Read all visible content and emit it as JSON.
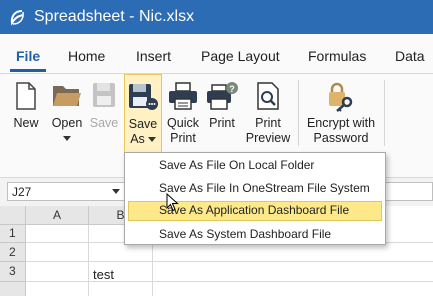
{
  "window": {
    "title": "Spreadsheet - Nic.xlsx",
    "accent_color": "#2b6cb5"
  },
  "tabs": [
    {
      "label": "File",
      "active": true
    },
    {
      "label": "Home"
    },
    {
      "label": "Insert"
    },
    {
      "label": "Page Layout"
    },
    {
      "label": "Formulas"
    },
    {
      "label": "Data"
    }
  ],
  "ribbon": {
    "new": {
      "label": "New",
      "icon": "new-document-icon"
    },
    "open": {
      "label": "Open",
      "icon": "folder-open-icon"
    },
    "save": {
      "label": "Save",
      "icon": "floppy-disk-icon",
      "disabled": true
    },
    "save_as": {
      "line1": "Save",
      "line2": "As",
      "icon": "save-as-icon"
    },
    "quick_print": {
      "line1": "Quick",
      "line2": "Print",
      "icon": "printer-icon"
    },
    "print": {
      "label": "Print",
      "icon": "printer-help-icon"
    },
    "print_preview": {
      "line1": "Print",
      "line2": "Preview",
      "icon": "print-preview-icon"
    },
    "encrypt": {
      "line1": "Encrypt with",
      "line2": "Password",
      "icon": "padlock-key-icon"
    }
  },
  "name_box": {
    "value": "J27"
  },
  "save_as_menu": [
    {
      "label": "Save As File On Local Folder"
    },
    {
      "label": "Save As File In OneStream File System"
    },
    {
      "label": "Save As Application Dashboard File",
      "highlighted": true
    },
    {
      "label": "Save As System Dashboard File"
    }
  ],
  "sheet": {
    "columns": [
      "A",
      "B"
    ],
    "rows": [
      "1",
      "2",
      "3",
      ""
    ],
    "cells": {
      "B3": "test"
    }
  }
}
